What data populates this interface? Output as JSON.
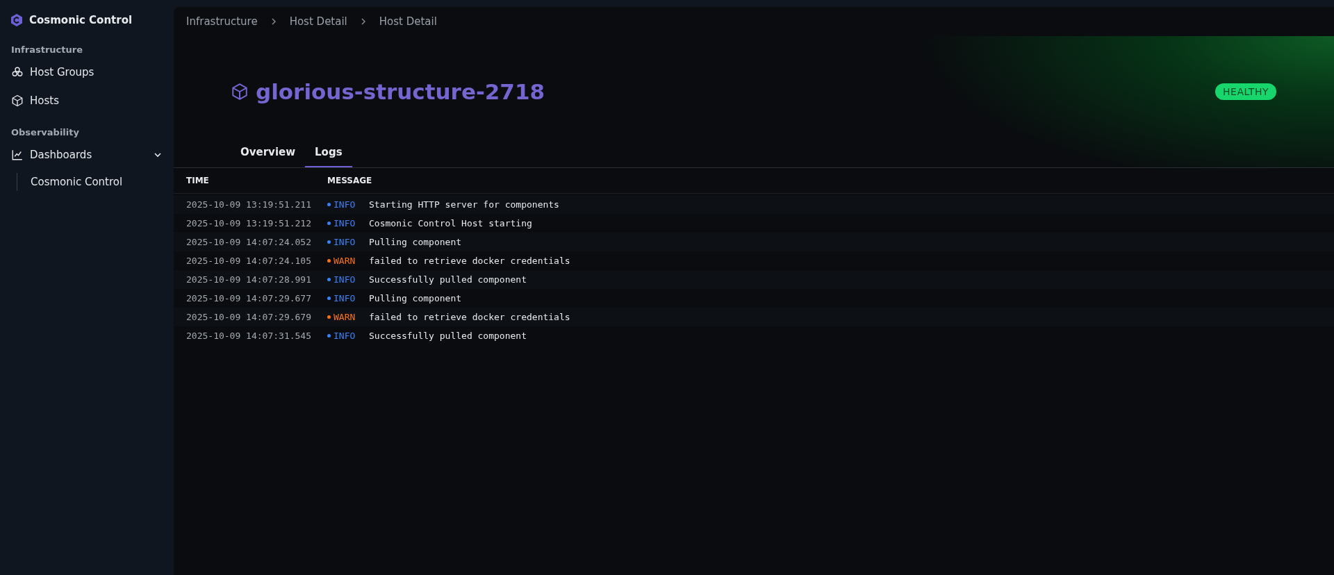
{
  "app": {
    "title": "Cosmonic Control"
  },
  "sidebar": {
    "sections": [
      {
        "heading": "Infrastructure",
        "items": [
          {
            "label": "Host Groups",
            "kind": "groups"
          },
          {
            "label": "Hosts",
            "kind": "cube"
          }
        ]
      },
      {
        "heading": "Observability",
        "items": [
          {
            "label": "Dashboards",
            "kind": "chart",
            "expanded": true,
            "children": [
              {
                "label": "Cosmonic Control"
              }
            ]
          }
        ]
      }
    ]
  },
  "breadcrumb": [
    "Infrastructure",
    "Host Detail",
    "Host Detail"
  ],
  "host": {
    "name": "glorious-structure-2718",
    "status": "HEALTHY"
  },
  "tabs": [
    {
      "label": "Overview",
      "selected": false
    },
    {
      "label": "Logs",
      "selected": true
    }
  ],
  "table": {
    "columns": [
      "TIME",
      "MESSAGE"
    ],
    "rows": [
      {
        "time": "2025-10-09 13:19:51.211",
        "kind": "info",
        "level_label": "INFO",
        "message": "Starting HTTP server for components"
      },
      {
        "time": "2025-10-09 13:19:51.212",
        "kind": "info",
        "level_label": "INFO",
        "message": "Cosmonic Control Host starting"
      },
      {
        "time": "2025-10-09 14:07:24.052",
        "kind": "info",
        "level_label": "INFO",
        "message": "Pulling component"
      },
      {
        "time": "2025-10-09 14:07:24.105",
        "kind": "warn",
        "level_label": "WARN",
        "message": "failed to retrieve docker credentials"
      },
      {
        "time": "2025-10-09 14:07:28.991",
        "kind": "info",
        "level_label": "INFO",
        "message": "Successfully pulled component"
      },
      {
        "time": "2025-10-09 14:07:29.677",
        "kind": "info",
        "level_label": "INFO",
        "message": "Pulling component"
      },
      {
        "time": "2025-10-09 14:07:29.679",
        "kind": "warn",
        "level_label": "WARN",
        "message": "failed to retrieve docker credentials"
      },
      {
        "time": "2025-10-09 14:07:31.545",
        "kind": "info",
        "level_label": "INFO",
        "message": "Successfully pulled component"
      }
    ]
  }
}
